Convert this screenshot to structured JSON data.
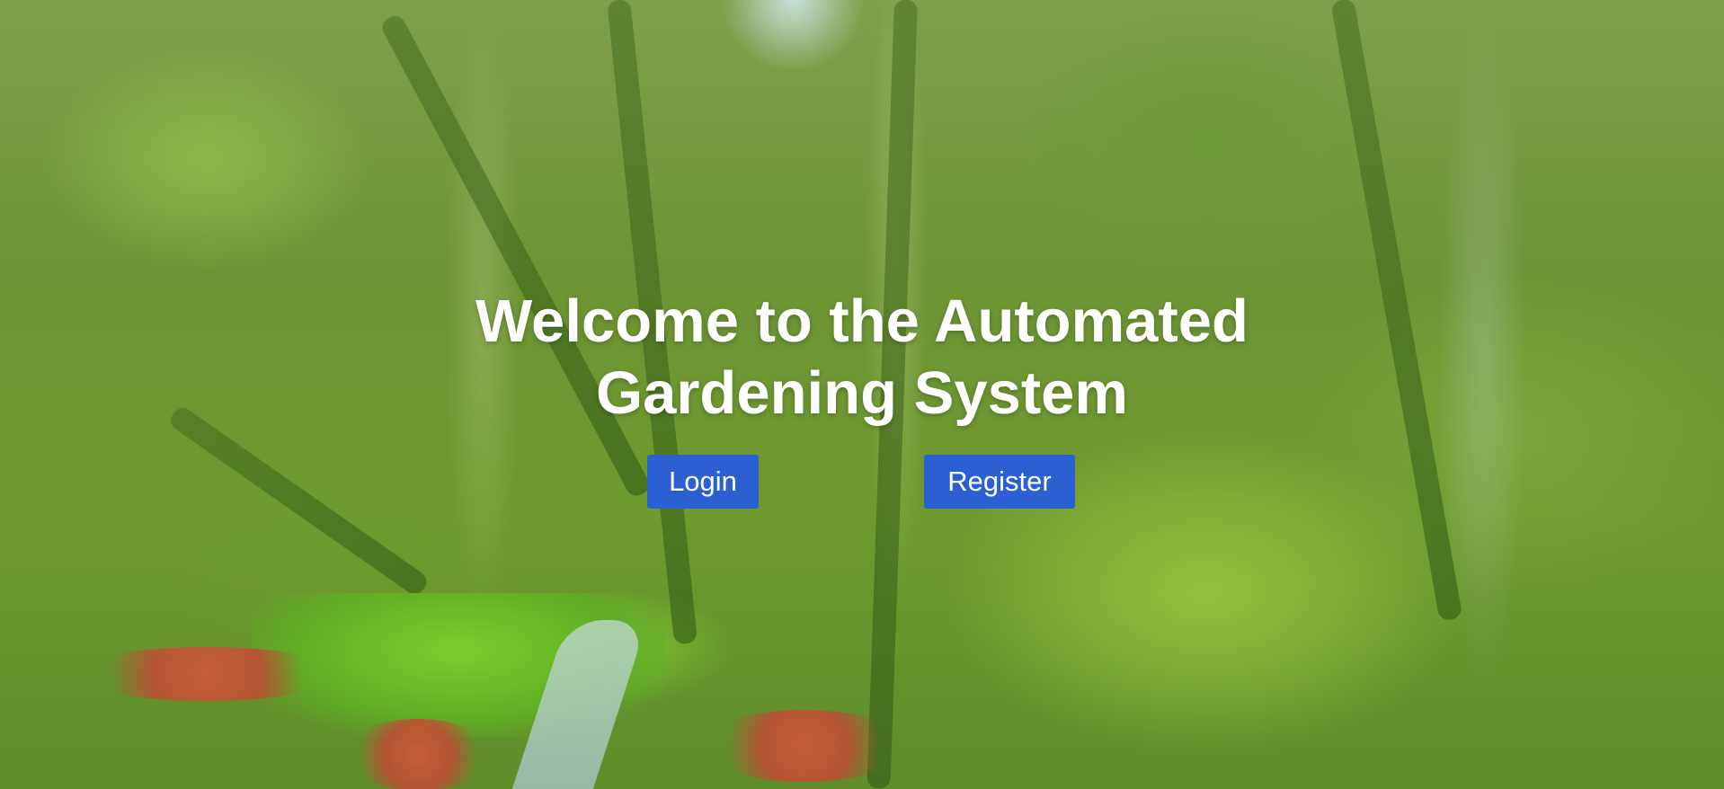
{
  "hero": {
    "title": "Welcome to the Automated Gardening System",
    "background": "garden-forest-photo"
  },
  "actions": {
    "login_label": "Login",
    "register_label": "Register"
  },
  "colors": {
    "button_bg": "#2c5fd1",
    "button_text": "#ffffff",
    "title_text": "#ffffff"
  }
}
